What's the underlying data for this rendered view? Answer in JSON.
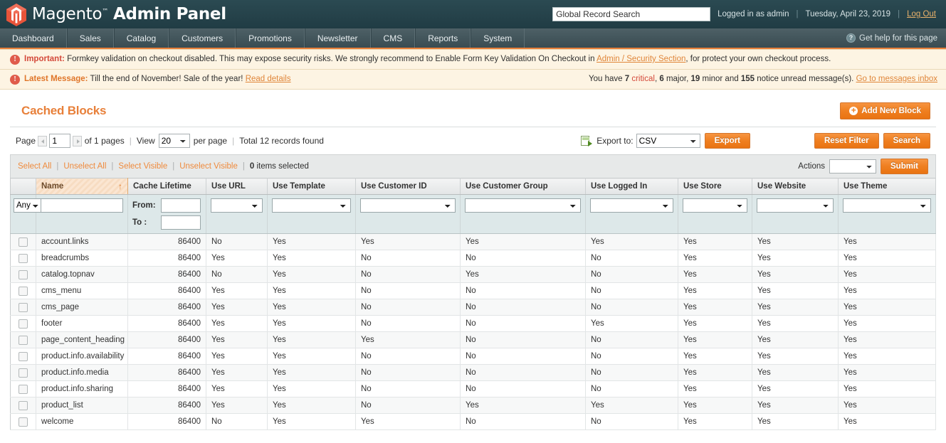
{
  "header": {
    "logo_text_light": "Magento",
    "logo_tm": "™",
    "logo_text_bold": "Admin Panel",
    "search_placeholder": "",
    "search_value": "Global Record Search",
    "logged_in": "Logged in as admin",
    "sep": "|",
    "date": "Tuesday, April 23, 2019",
    "logout": "Log Out"
  },
  "nav": {
    "items": [
      {
        "label": "Dashboard"
      },
      {
        "label": "Sales"
      },
      {
        "label": "Catalog"
      },
      {
        "label": "Customers"
      },
      {
        "label": "Promotions"
      },
      {
        "label": "Newsletter"
      },
      {
        "label": "CMS"
      },
      {
        "label": "Reports"
      },
      {
        "label": "System"
      }
    ],
    "help": "Get help for this page",
    "help_icon": "?"
  },
  "messages": {
    "important": {
      "icon": "!",
      "label": "Important:",
      "text_before": "Formkey validation on checkout disabled. This may expose security risks. We strongly recommend to Enable Form Key Validation On Checkout in",
      "link": "Admin / Security Section",
      "text_after": ", for protect your own checkout process."
    },
    "latest": {
      "icon": "!",
      "label": "Latest Message:",
      "text": "Till the end of November! Sale of the year!",
      "link": "Read details",
      "counts_prefix": "You have",
      "critical_n": "7",
      "critical_w": "critical",
      "comma1": ",",
      "major_n": "6",
      "major_w": "major",
      "comma2": ",",
      "minor_n": "19",
      "minor_w": "minor and",
      "notice_n": "155",
      "notice_w": "notice unread message(s).",
      "inbox_link": "Go to messages inbox"
    }
  },
  "page": {
    "title": "Cached Blocks",
    "add_button": "Add New Block",
    "add_icon": "+"
  },
  "toolbar": {
    "page_label": "Page",
    "page_value": "1",
    "of_pages": "of 1 pages",
    "sep": "|",
    "view_label": "View",
    "view_value": "20",
    "per_page": "per page",
    "total": "Total 12 records found",
    "export_label": "Export to:",
    "export_value": "CSV",
    "export_button": "Export",
    "reset_filter_button": "Reset Filter",
    "search_button": "Search"
  },
  "massaction": {
    "select_all": "Select All",
    "unselect_all": "Unselect All",
    "select_visible": "Select Visible",
    "unselect_visible": "Unselect Visible",
    "sep": "|",
    "count_n": "0",
    "count_label": "items selected",
    "actions_label": "Actions",
    "actions_value": "",
    "submit_button": "Submit"
  },
  "grid": {
    "columns": [
      {
        "label": "Name",
        "sorted": true,
        "sort_dir": "↑"
      },
      {
        "label": "Cache Lifetime",
        "sorted": false
      },
      {
        "label": "Use URL",
        "sorted": false
      },
      {
        "label": "Use Template",
        "sorted": false
      },
      {
        "label": "Use Customer ID",
        "sorted": false
      },
      {
        "label": "Use Customer Group",
        "sorted": false
      },
      {
        "label": "Use Logged In",
        "sorted": false
      },
      {
        "label": "Use Store",
        "sorted": false
      },
      {
        "label": "Use Website",
        "sorted": false
      },
      {
        "label": "Use Theme",
        "sorted": false
      }
    ],
    "filters": {
      "any_value": "Any",
      "name_value": "",
      "from_label": "From:",
      "from_value": "",
      "to_label": "To :",
      "to_value": ""
    },
    "rows": [
      {
        "name": "account.links",
        "lifetime": "86400",
        "use_url": "No",
        "use_template": "Yes",
        "use_customer_id": "Yes",
        "use_customer_group": "Yes",
        "use_logged_in": "Yes",
        "use_store": "Yes",
        "use_website": "Yes",
        "use_theme": "Yes"
      },
      {
        "name": "breadcrumbs",
        "lifetime": "86400",
        "use_url": "Yes",
        "use_template": "Yes",
        "use_customer_id": "No",
        "use_customer_group": "No",
        "use_logged_in": "No",
        "use_store": "Yes",
        "use_website": "Yes",
        "use_theme": "Yes"
      },
      {
        "name": "catalog.topnav",
        "lifetime": "86400",
        "use_url": "No",
        "use_template": "Yes",
        "use_customer_id": "No",
        "use_customer_group": "Yes",
        "use_logged_in": "No",
        "use_store": "Yes",
        "use_website": "Yes",
        "use_theme": "Yes"
      },
      {
        "name": "cms_menu",
        "lifetime": "86400",
        "use_url": "Yes",
        "use_template": "Yes",
        "use_customer_id": "No",
        "use_customer_group": "No",
        "use_logged_in": "No",
        "use_store": "Yes",
        "use_website": "Yes",
        "use_theme": "Yes"
      },
      {
        "name": "cms_page",
        "lifetime": "86400",
        "use_url": "Yes",
        "use_template": "Yes",
        "use_customer_id": "No",
        "use_customer_group": "No",
        "use_logged_in": "No",
        "use_store": "Yes",
        "use_website": "Yes",
        "use_theme": "Yes"
      },
      {
        "name": "footer",
        "lifetime": "86400",
        "use_url": "Yes",
        "use_template": "Yes",
        "use_customer_id": "No",
        "use_customer_group": "No",
        "use_logged_in": "Yes",
        "use_store": "Yes",
        "use_website": "Yes",
        "use_theme": "Yes"
      },
      {
        "name": "page_content_heading",
        "lifetime": "86400",
        "use_url": "Yes",
        "use_template": "Yes",
        "use_customer_id": "Yes",
        "use_customer_group": "No",
        "use_logged_in": "No",
        "use_store": "Yes",
        "use_website": "Yes",
        "use_theme": "Yes"
      },
      {
        "name": "product.info.availability",
        "lifetime": "86400",
        "use_url": "Yes",
        "use_template": "Yes",
        "use_customer_id": "No",
        "use_customer_group": "No",
        "use_logged_in": "No",
        "use_store": "Yes",
        "use_website": "Yes",
        "use_theme": "Yes"
      },
      {
        "name": "product.info.media",
        "lifetime": "86400",
        "use_url": "Yes",
        "use_template": "Yes",
        "use_customer_id": "No",
        "use_customer_group": "No",
        "use_logged_in": "No",
        "use_store": "Yes",
        "use_website": "Yes",
        "use_theme": "Yes"
      },
      {
        "name": "product.info.sharing",
        "lifetime": "86400",
        "use_url": "Yes",
        "use_template": "Yes",
        "use_customer_id": "No",
        "use_customer_group": "No",
        "use_logged_in": "No",
        "use_store": "Yes",
        "use_website": "Yes",
        "use_theme": "Yes"
      },
      {
        "name": "product_list",
        "lifetime": "86400",
        "use_url": "Yes",
        "use_template": "Yes",
        "use_customer_id": "No",
        "use_customer_group": "Yes",
        "use_logged_in": "Yes",
        "use_store": "Yes",
        "use_website": "Yes",
        "use_theme": "Yes"
      },
      {
        "name": "welcome",
        "lifetime": "86400",
        "use_url": "No",
        "use_template": "Yes",
        "use_customer_id": "Yes",
        "use_customer_group": "No",
        "use_logged_in": "No",
        "use_store": "Yes",
        "use_website": "Yes",
        "use_theme": "Yes"
      }
    ]
  },
  "colors": {
    "accent_orange": "#e8803a",
    "header_teal": "#26434b",
    "nav_gray": "#44575d",
    "message_bg": "#fdf4e3",
    "filter_bg": "#dde8e9"
  }
}
